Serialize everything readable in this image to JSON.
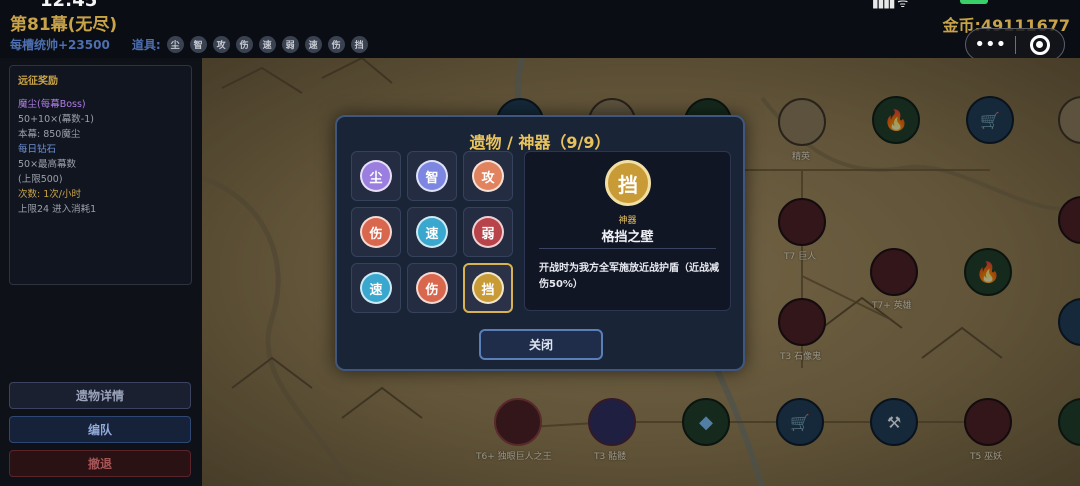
{
  "status_bar": {
    "time": "12:45",
    "signal_text": "▮▮▮▮ ᯤ"
  },
  "header": {
    "stage_title": "第81幕(无尽)",
    "gold": "金币:49111677",
    "bonus": "每槽统帅+23500",
    "items_label": "道具:",
    "items": [
      "尘",
      "智",
      "攻",
      "伤",
      "速",
      "弱",
      "速",
      "伤",
      "挡"
    ]
  },
  "capsule": {
    "more": "•••"
  },
  "rewards": {
    "heading": "远征奖励",
    "lines": [
      {
        "text": "魔尘(每幕Boss)",
        "tone": "purple"
      },
      {
        "text": "50+10×(幕数-1)",
        "tone": "grey"
      },
      {
        "text": "本幕: 850魔尘",
        "tone": "grey"
      },
      {
        "text": "每日钻石",
        "tone": "blue"
      },
      {
        "text": "50×最高幕数",
        "tone": "grey"
      },
      {
        "text": "(上限500)",
        "tone": "grey"
      },
      {
        "text": "次数: 1次/小时",
        "tone": "gold"
      },
      {
        "text": "上限24 进入消耗1",
        "tone": "grey"
      }
    ]
  },
  "left_buttons": {
    "details": "遗物详情",
    "formation": "编队",
    "retreat": "撤退"
  },
  "map": {
    "labels": [
      "精英",
      "T7 巨人",
      "T7+ 英雄",
      "T3 石像鬼",
      "T6+ 独眼巨人之王",
      "T3 骷髅",
      "T5 巫妖"
    ]
  },
  "modal": {
    "title": "遗物 / 神器（9/9）",
    "relics": [
      {
        "glyph": "尘",
        "color": "#9b7fe0"
      },
      {
        "glyph": "智",
        "color": "#7d86e0"
      },
      {
        "glyph": "攻",
        "color": "#e0835e"
      },
      {
        "glyph": "伤",
        "color": "#d8674d"
      },
      {
        "glyph": "速",
        "color": "#3aa7cf"
      },
      {
        "glyph": "弱",
        "color": "#b8434a"
      },
      {
        "glyph": "速",
        "color": "#3aa7cf"
      },
      {
        "glyph": "伤",
        "color": "#d8674d"
      },
      {
        "glyph": "挡",
        "color": "#c99b37"
      }
    ],
    "selected_index": 8,
    "detail": {
      "glyph": "挡",
      "category": "神器",
      "name": "格挡之壁",
      "description": "开战时为我方全军施放近战护盾（近战减伤50%）"
    },
    "close_label": "关闭"
  }
}
